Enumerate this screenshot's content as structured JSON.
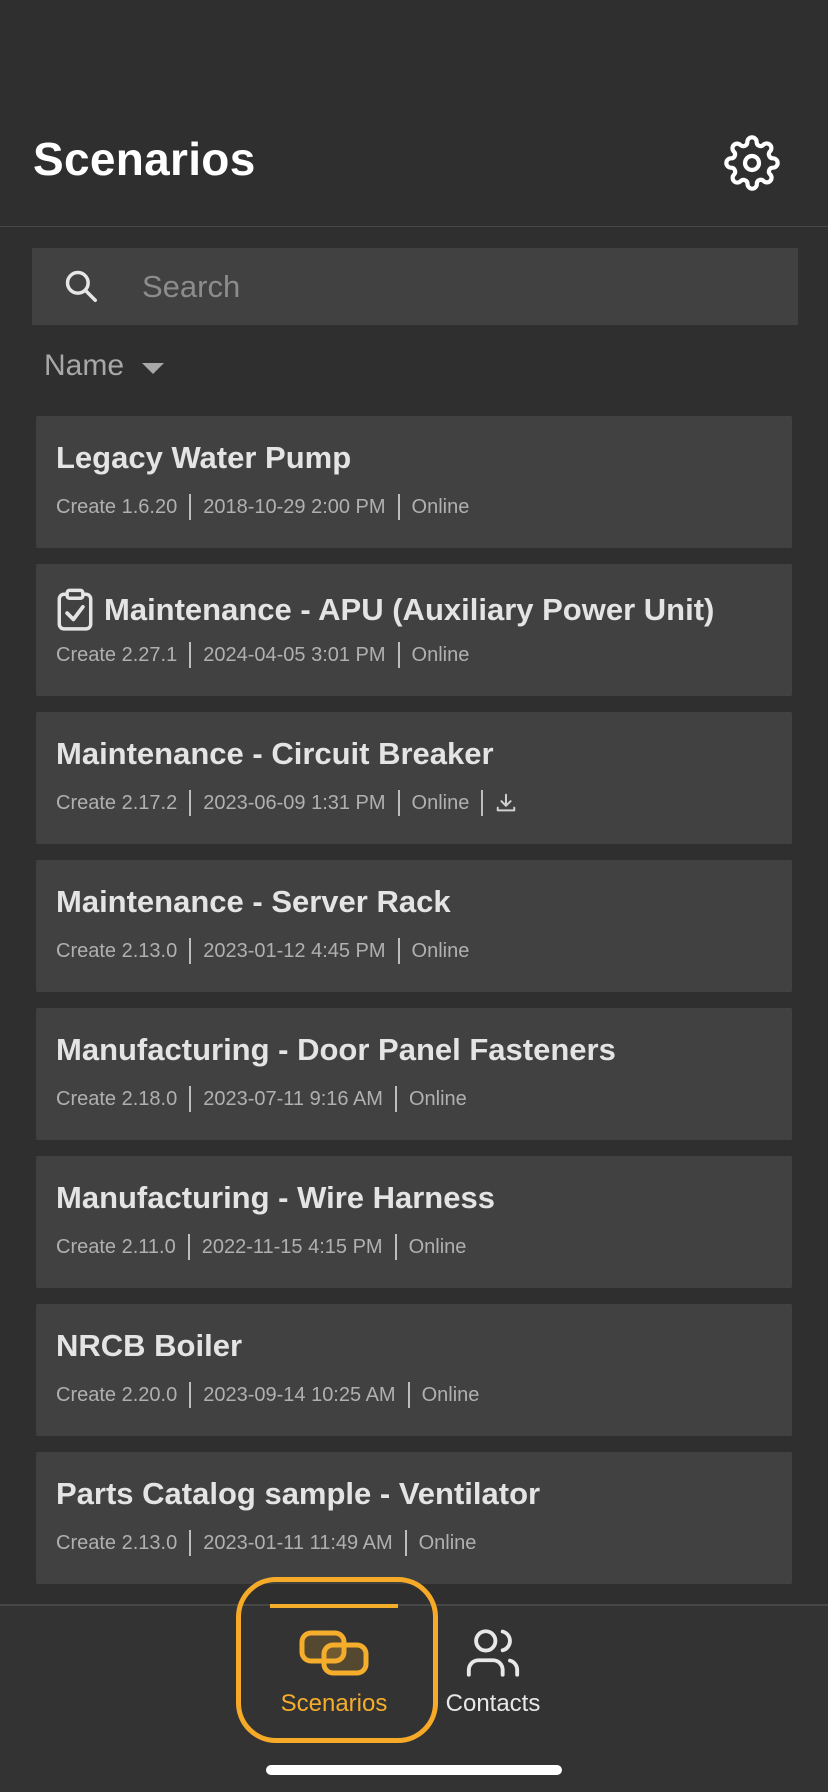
{
  "header": {
    "title": "Scenarios"
  },
  "search": {
    "placeholder": "Search"
  },
  "sort": {
    "label": "Name"
  },
  "scenarios": [
    {
      "title": "Legacy Water Pump",
      "version": "Create 1.6.20",
      "date": "2018-10-29 2:00 PM",
      "status": "Online",
      "checklist": false,
      "downloadable": false
    },
    {
      "title": "Maintenance - APU (Auxiliary Power Unit)",
      "version": "Create 2.27.1",
      "date": "2024-04-05 3:01 PM",
      "status": "Online",
      "checklist": true,
      "downloadable": false
    },
    {
      "title": "Maintenance - Circuit Breaker",
      "version": "Create 2.17.2",
      "date": "2023-06-09 1:31 PM",
      "status": "Online",
      "checklist": false,
      "downloadable": true
    },
    {
      "title": "Maintenance - Server Rack",
      "version": "Create 2.13.0",
      "date": "2023-01-12 4:45 PM",
      "status": "Online",
      "checklist": false,
      "downloadable": false
    },
    {
      "title": "Manufacturing - Door Panel Fasteners",
      "version": "Create 2.18.0",
      "date": "2023-07-11 9:16 AM",
      "status": "Online",
      "checklist": false,
      "downloadable": false
    },
    {
      "title": "Manufacturing - Wire Harness",
      "version": "Create 2.11.0",
      "date": "2022-11-15 4:15 PM",
      "status": "Online",
      "checklist": false,
      "downloadable": false
    },
    {
      "title": "NRCB Boiler",
      "version": "Create 2.20.0",
      "date": "2023-09-14 10:25 AM",
      "status": "Online",
      "checklist": false,
      "downloadable": false
    },
    {
      "title": "Parts Catalog sample - Ventilator",
      "version": "Create 2.13.0",
      "date": "2023-01-11 11:49 AM",
      "status": "Online",
      "checklist": false,
      "downloadable": false
    }
  ],
  "nav": {
    "scenarios_label": "Scenarios",
    "contacts_label": "Contacts"
  },
  "icons": {
    "settings": "gear-icon",
    "search": "search-icon",
    "sort": "caret-down-icon",
    "checklist": "clipboard-check-icon",
    "download": "download-icon",
    "scenarios_tab": "linked-boxes-icon",
    "contacts_tab": "users-icon"
  },
  "colors": {
    "background": "#2f2f2f",
    "card": "#414141",
    "accent": "#f5ad2c",
    "text": "#e4e4e4",
    "muted": "#b0b0b0"
  }
}
